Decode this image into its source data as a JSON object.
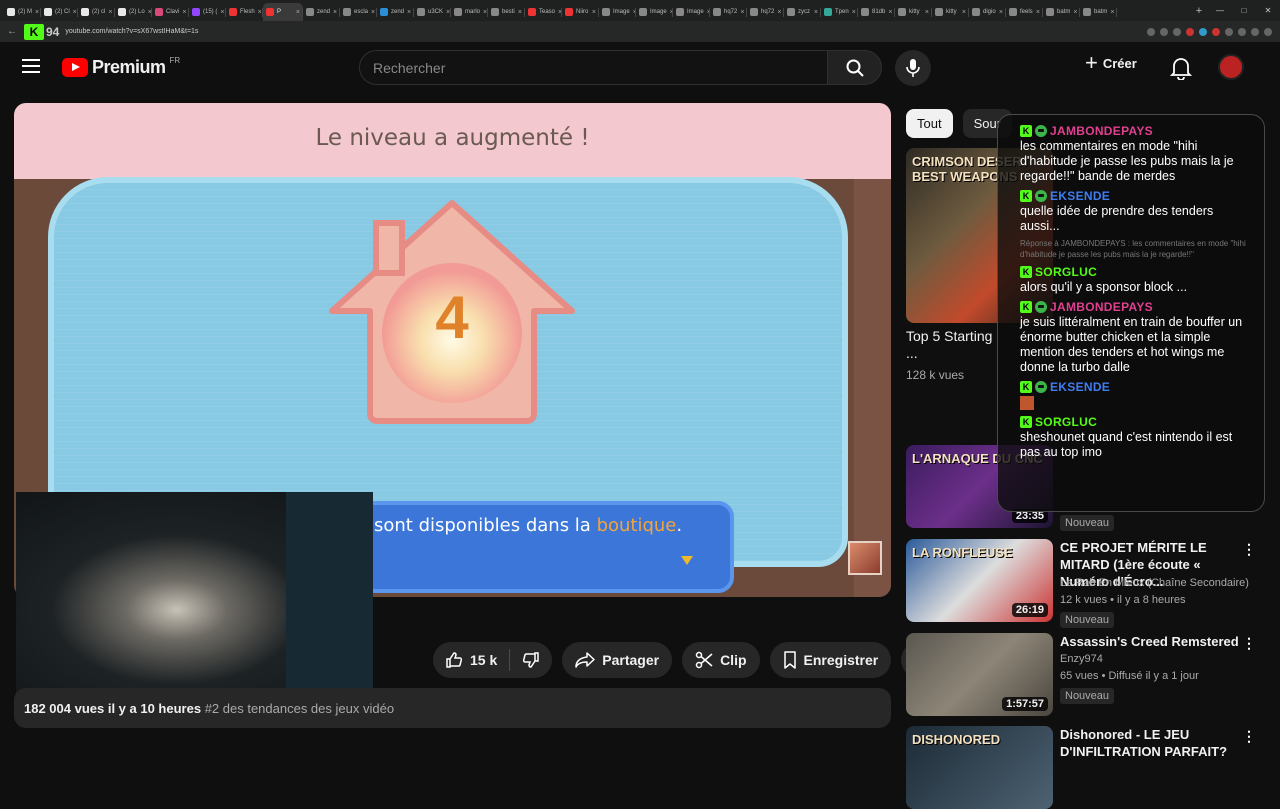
{
  "browser": {
    "tabs": [
      {
        "label": "(2) M",
        "color": "#e8e8e8"
      },
      {
        "label": "(2) Cl",
        "color": "#e8e8e8"
      },
      {
        "label": "(2) cl",
        "color": "#e8e8e8"
      },
      {
        "label": "(2) Lo",
        "color": "#e8e8e8"
      },
      {
        "label": "Clavi",
        "color": "#d84a7a"
      },
      {
        "label": "(15) (",
        "color": "#9146ff"
      },
      {
        "label": "Flesh",
        "color": "#e33"
      },
      {
        "label": "P",
        "color": "#e33",
        "active": true
      },
      {
        "label": "zend",
        "color": "#888"
      },
      {
        "label": "escla",
        "color": "#888"
      },
      {
        "label": "zend",
        "color": "#2a8fd6"
      },
      {
        "label": "u3CK",
        "color": "#888"
      },
      {
        "label": "marlo",
        "color": "#888"
      },
      {
        "label": "besti",
        "color": "#888"
      },
      {
        "label": "Teaso",
        "color": "#e33"
      },
      {
        "label": "Niiro",
        "color": "#e33"
      },
      {
        "label": "Image",
        "color": "#888"
      },
      {
        "label": "Image",
        "color": "#888"
      },
      {
        "label": "Image",
        "color": "#888"
      },
      {
        "label": "hq72",
        "color": "#888"
      },
      {
        "label": "hq72",
        "color": "#888"
      },
      {
        "label": "zycz",
        "color": "#888"
      },
      {
        "label": "Tpen",
        "color": "#3a9"
      },
      {
        "label": "81db",
        "color": "#888"
      },
      {
        "label": "kitty",
        "color": "#888"
      },
      {
        "label": "kitty",
        "color": "#888"
      },
      {
        "label": "digio",
        "color": "#888"
      },
      {
        "label": "feels",
        "color": "#888"
      },
      {
        "label": "batm",
        "color": "#888"
      },
      {
        "label": "batm",
        "color": "#888"
      }
    ],
    "new_tab": "+",
    "url": "youtube.com/watch?v=sX67wstIHaM&t=1s",
    "overlay_logo": "K",
    "overlay_num": "94"
  },
  "youtube": {
    "logo_text": "Premium",
    "country": "FR",
    "search_placeholder": "Rechercher",
    "create_label": "Créer"
  },
  "video": {
    "level_title": "Le niveau a augmenté !",
    "level_number": "4",
    "dialog_text": "sont disponibles dans la ",
    "dialog_highlight": "boutique",
    "dialog_end": "."
  },
  "actions": {
    "likes": "15 k",
    "share": "Partager",
    "clip": "Clip",
    "save": "Enregistrer"
  },
  "description": {
    "stats": "182 004 vues  il y a 10 heures ",
    "tag": "#2 des tendances des jeux vidéo"
  },
  "chips": [
    "Tout",
    "Sour"
  ],
  "recommendations": [
    {
      "title": "Top 5 Starting ...",
      "channel": "",
      "meta": "128 k vues",
      "duration": "",
      "thumb": "linear-gradient(135deg,#2e2b24,#6e5b3f 40%,#c24a2b 70%,#3a2a20)",
      "thumb_text": "CRIMSON DESERT BEST WEAPONS"
    },
    {
      "title": "",
      "channel": "",
      "meta": "",
      "duration": "23:35",
      "badge": "Nouveau",
      "thumb": "linear-gradient(135deg,#3a1c5e,#6c2f8a 50%,#1c1530)",
      "thumb_text": "L'ARNAQUE DU CNC"
    },
    {
      "title": "CE PROJET MÉRITE LE MITARD (1ère écoute « Numéro d'Écro...",
      "channel": "Le Rab En Mieux (Chaîne Secondaire)",
      "meta": "12 k vues • il y a 8 heures",
      "duration": "26:19",
      "badge": "Nouveau",
      "thumb": "linear-gradient(135deg,#2a5a9a,#ddd 50%,#c33)",
      "thumb_text": "LA RONFLEUSE"
    },
    {
      "title": "Assassin's Creed Remstered",
      "channel": "Enzy974",
      "meta": "65 vues • Diffusé il y a 1 jour",
      "duration": "1:57:57",
      "badge": "Nouveau",
      "thumb": "linear-gradient(135deg,#5a5750,#8d8577 50%,#4a463f)",
      "thumb_text": ""
    },
    {
      "title": "Dishonored - LE JEU D'INFILTRATION PARFAIT?",
      "channel": "",
      "meta": "",
      "duration": "",
      "thumb": "linear-gradient(135deg,#1c2a36,#4d6272)",
      "thumb_text": "DISHONORED"
    }
  ],
  "chat": [
    {
      "user": "JAMBONDEPAYS",
      "color": "#e0408f",
      "text": "les commentaires en mode \"hihi d'habitude je passe les pubs mais la je regarde!!\" bande de merdes",
      "skull": true
    },
    {
      "user": "EKSENDE",
      "color": "#3f7df0",
      "text": "quelle idée de prendre des tenders aussi...",
      "skull": true
    },
    {
      "ghost": "Réponse à JAMBONDEPAYS : les commentaires en mode \"hihi d'habitude je passe les pubs mais la je regarde!!\""
    },
    {
      "user": "SORGLUC",
      "color": "#53fc18",
      "text": "alors qu'il y a sponsor block ...",
      "skull": false
    },
    {
      "user": "JAMBONDEPAYS",
      "color": "#e0408f",
      "text": "je suis littéralment en train de bouffer un énorme butter chicken et la simple mention des tenders et hot wings me donne la turbo dalle",
      "skull": true
    },
    {
      "user": "EKSENDE",
      "color": "#3f7df0",
      "text": "",
      "skull": true
    },
    {
      "user": "SORGLUC",
      "color": "#53fc18",
      "text": "sheshounet quand c'est nintendo il est pas au top imo",
      "skull": false
    }
  ]
}
